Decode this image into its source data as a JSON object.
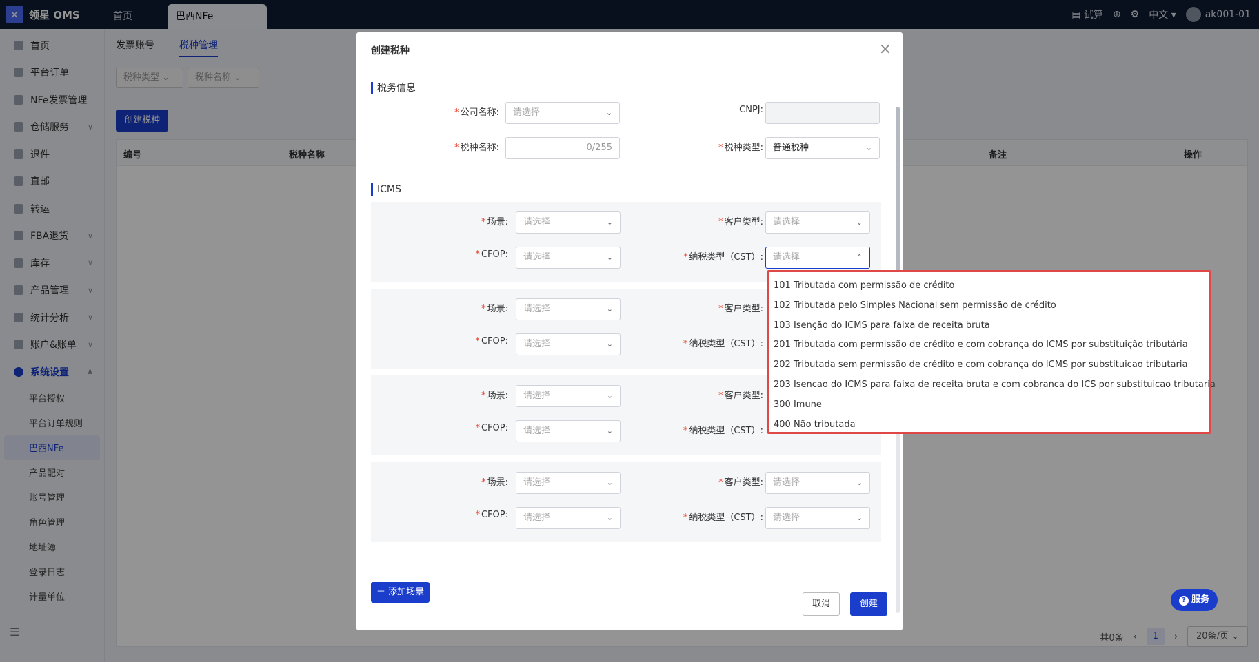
{
  "app": {
    "logo": "领星 OMS",
    "tabs": [
      "首页",
      "巴西NFe"
    ]
  },
  "topbar": {
    "trial": "试算",
    "lang": "中文",
    "user": "ak001-01"
  },
  "sidebar": {
    "items": [
      {
        "label": "首页",
        "expand": false
      },
      {
        "label": "平台订单",
        "expand": false
      },
      {
        "label": "NFe发票管理",
        "expand": false
      },
      {
        "label": "仓储服务",
        "expand": true
      },
      {
        "label": "退件",
        "expand": false
      },
      {
        "label": "直邮",
        "expand": false
      },
      {
        "label": "转运",
        "expand": false
      },
      {
        "label": "FBA退货",
        "expand": true
      },
      {
        "label": "库存",
        "expand": true
      },
      {
        "label": "产品管理",
        "expand": true
      },
      {
        "label": "统计分析",
        "expand": true
      },
      {
        "label": "账户&账单",
        "expand": true
      },
      {
        "label": "系统设置",
        "expand": true
      }
    ],
    "sub_items": [
      "平台授权",
      "平台订单规则",
      "巴西NFe",
      "产品配对",
      "账号管理",
      "角色管理",
      "地址簿",
      "登录日志",
      "计量单位"
    ],
    "active_sub": "巴西NFe"
  },
  "page": {
    "subtabs": [
      "发票账号",
      "税种管理"
    ],
    "filters": [
      "税种类型",
      "税种名称"
    ],
    "create_button": "创建税种",
    "columns": [
      "编号",
      "税种名称",
      "备注",
      "操作"
    ],
    "pager": {
      "total": "共0条",
      "page": "1",
      "page_size": "20条/页"
    }
  },
  "modal": {
    "title": "创建税种",
    "section_tax": "税务信息",
    "company_label": "公司名称:",
    "company_placeholder": "请选择",
    "cnpj_label": "CNPJ:",
    "tax_name_label": "税种名称:",
    "tax_name_counter": "0/255",
    "tax_type_label": "税种类型:",
    "tax_type_value": "普通税种",
    "section_icms": "ICMS",
    "scene_label": "场景:",
    "customer_label": "客户类型:",
    "cfop_label": "CFOP:",
    "cst_label": "纳税类型（CST）:",
    "placeholder": "请选择",
    "add_scene": "添加场景",
    "cancel": "取消",
    "create": "创建"
  },
  "dropdown": {
    "options": [
      "101 Tributada com permissão de crédito",
      "102 Tributada pelo Simples Nacional sem permissão de crédito",
      "103 Isenção do ICMS para faixa de receita bruta",
      "201 Tributada com permissão de crédito e com cobrança do ICMS por substituição tributária",
      "202 Tributada sem permissão de crédito e com cobrança do ICMS por substituicao tributaria",
      "203 Isencao do ICMS para faixa de receita bruta e com cobranca do ICS por substituicao tributaria",
      "300 Imune",
      "400 Não tributada"
    ]
  },
  "service_button": "服务",
  "colors": {
    "accent": "#1a3dcc",
    "topbar": "#0f1c33",
    "highlight": "#e04848"
  }
}
